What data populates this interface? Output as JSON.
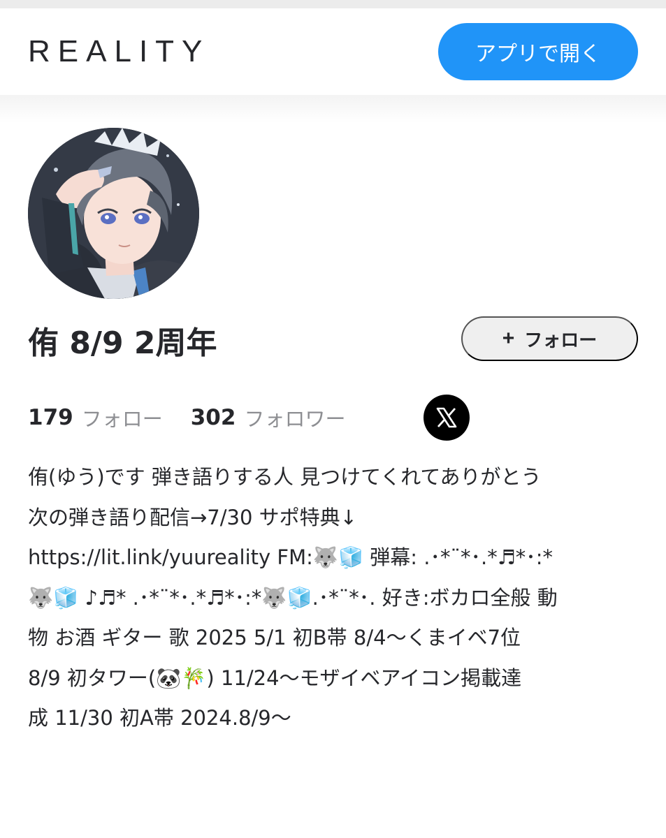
{
  "header": {
    "logo": "REALITY",
    "open_app_label": "アプリで開く"
  },
  "profile": {
    "display_name": "侑 8/9 2周年",
    "follow_label": "フォロー",
    "following_count": "179",
    "following_label": "フォロー",
    "followers_count": "302",
    "followers_label": "フォロワー",
    "social_icon": "x-logo-icon",
    "bio_lines": [
      "侑(ゆう)です 弾き語りする人 見つけてくれてありがとう",
      "次の弾き語り配信→7/30 サポ特典↓",
      "https://lit.link/yuureality FM:🐺🧊 弾幕: .･*¨*･.*♬*･:*",
      "🐺🧊 ♪♬* .･*¨*･.*♬*･:*🐺🧊.･*¨*･. 好き:ボカロ全般 動",
      "物 お酒 ギター 歌 2025 5/1 初B帯 8/4〜くまイベ7位",
      "8/9 初タワー(🐼🎋) 11/24〜モザイベアイコン掲載達",
      "成 11/30 初A帯 2024.8/9〜"
    ]
  },
  "colors": {
    "accent": "#2094f8",
    "text": "#26272b",
    "muted": "#8d8e92",
    "follow_bg": "#efefef"
  }
}
